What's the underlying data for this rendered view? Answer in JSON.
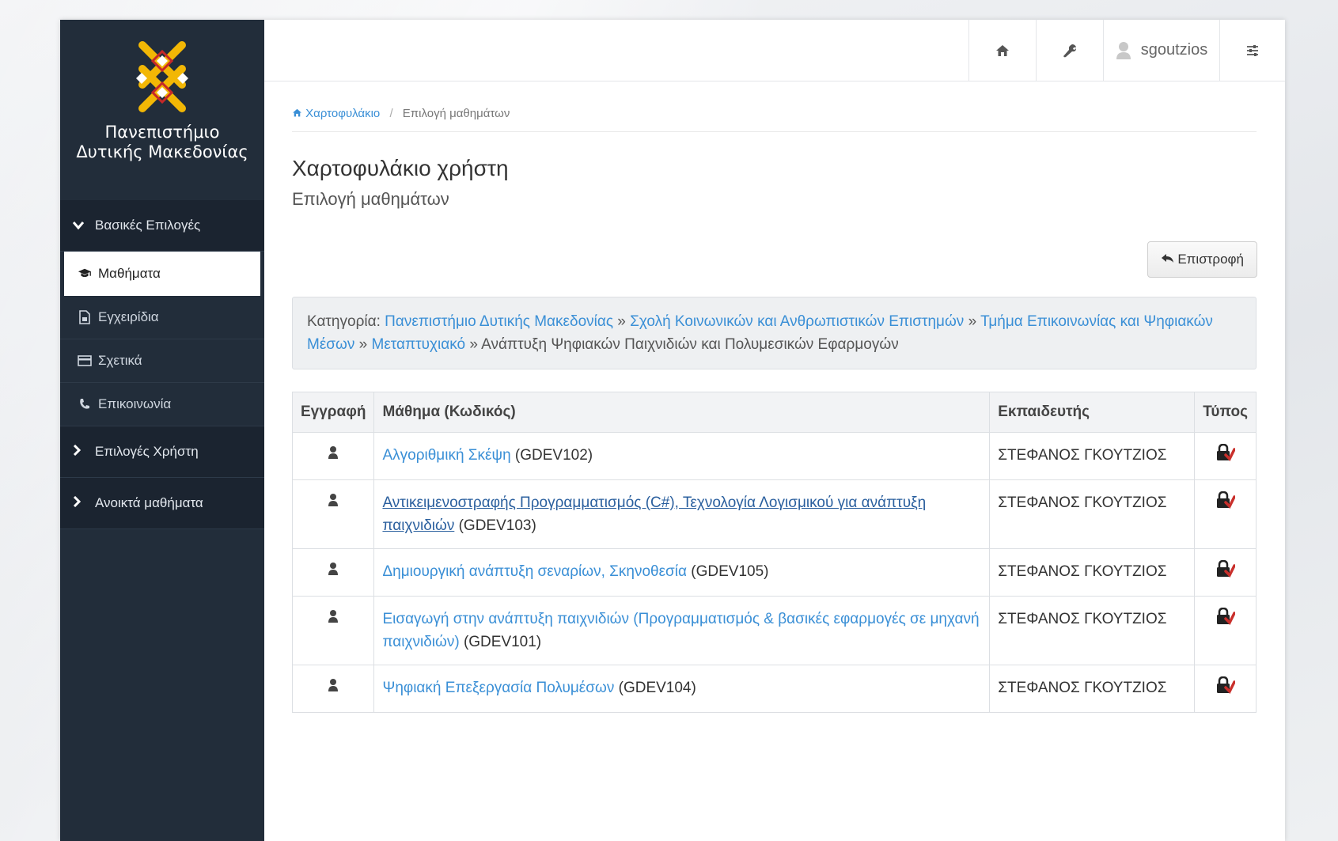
{
  "colors": {
    "sidebar_bg": "#222d3a",
    "sidebar_section_bg": "#1b2430",
    "link": "#3a8fd6",
    "lock_red": "#c9302c",
    "logo_gold": "#f2b705"
  },
  "sidebar": {
    "logo_line1": "Πανεπιστήμιο",
    "logo_line2": "Δυτικής Μακεδονίας",
    "section_basic": "Βασικές Επιλογές",
    "items": [
      {
        "label": "Μαθήματα",
        "icon": "graduation-cap-icon",
        "active": true
      },
      {
        "label": "Εγχειρίδια",
        "icon": "document-icon"
      },
      {
        "label": "Σχετικά",
        "icon": "card-icon"
      },
      {
        "label": "Επικοινωνία",
        "icon": "phone-icon"
      }
    ],
    "section_user": "Επιλογές Χρήστη",
    "section_open": "Ανοικτά μαθήματα"
  },
  "topbar": {
    "username": "sgoutzios",
    "icons": [
      "home-icon",
      "wrench-icon",
      "user-icon",
      "sliders-icon"
    ]
  },
  "breadcrumb": {
    "home": "Χαρτοφυλάκιο",
    "sep": "/",
    "current": "Επιλογή μαθημάτων"
  },
  "page": {
    "title": "Χαρτοφυλάκιο χρήστη",
    "subtitle": "Επιλογή μαθημάτων",
    "back_button": "Επιστροφή"
  },
  "category": {
    "label": "Κατηγορία:",
    "links": [
      "Πανεπιστήμιο Δυτικής Μακεδονίας",
      "Σχολή Κοινωνικών και Ανθρωπιστικών Επιστημών",
      "Τμήμα Επικοινωνίας και Ψηφιακών Μέσων",
      "Μεταπτυχιακό"
    ],
    "sep": "»",
    "current": "Ανάπτυξη Ψηφιακών Παιχνιδιών και Πολυμεσικών Εφαρμογών"
  },
  "table": {
    "headers": [
      "Εγγραφή",
      "Μάθημα (Κωδικός)",
      "Εκπαιδευτής",
      "Τύπος"
    ],
    "rows": [
      {
        "title": "Αλγοριθμική Σκέψη",
        "code": "(GDEV102)",
        "instructor": "ΣΤΕΦΑΝΟΣ ΓΚΟΥΤΖΙΟΣ"
      },
      {
        "title": "Αντικειμενοστραφής Προγραμματισμός (C#), Τεχνολογία Λογισμικού για ανάπτυξη παιχνιδιών",
        "code": "(GDEV103)",
        "instructor": "ΣΤΕΦΑΝΟΣ ΓΚΟΥΤΖΙΟΣ"
      },
      {
        "title": "Δημιουργική ανάπτυξη σεναρίων, Σκηνοθεσία",
        "code": "(GDEV105)",
        "instructor": "ΣΤΕΦΑΝΟΣ ΓΚΟΥΤΖΙΟΣ"
      },
      {
        "title": "Εισαγωγή στην ανάπτυξη παιχνιδιών (Προγραμματισμός & βασικές εφαρμογές σε μηχανή παιχνιδιών)",
        "code": "(GDEV101)",
        "instructor": "ΣΤΕΦΑΝΟΣ ΓΚΟΥΤΖΙΟΣ"
      },
      {
        "title": "Ψηφιακή Επεξεργασία Πολυμέσων",
        "code": "(GDEV104)",
        "instructor": "ΣΤΕΦΑΝΟΣ ΓΚΟΥΤΖΙΟΣ"
      }
    ]
  }
}
